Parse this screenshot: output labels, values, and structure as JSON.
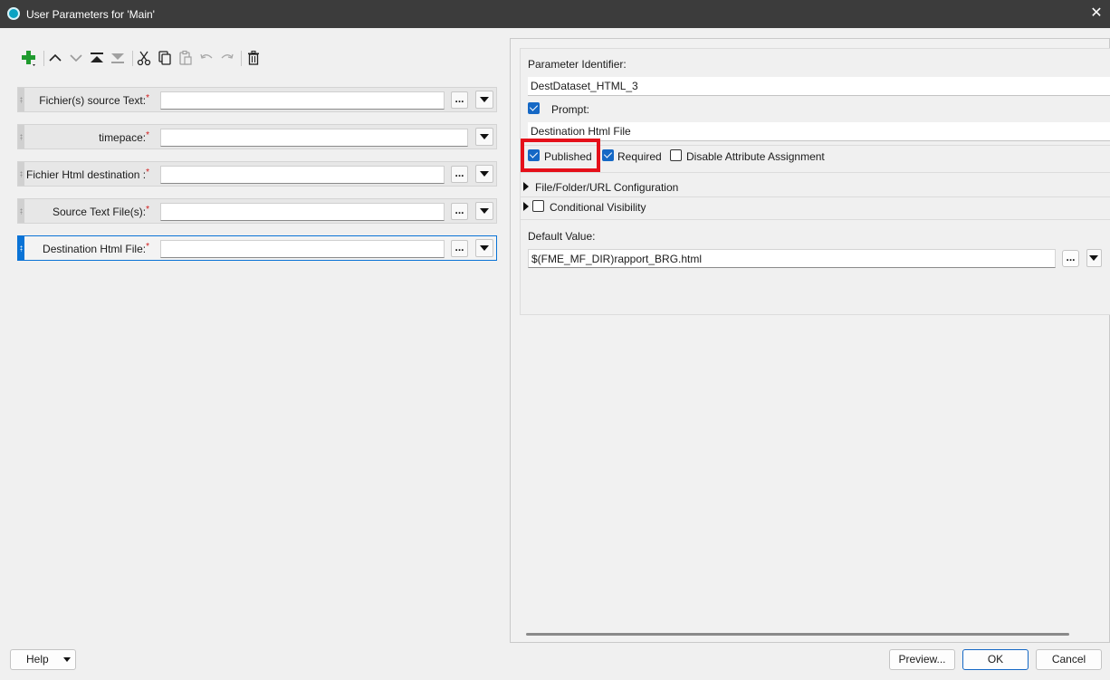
{
  "window": {
    "title": "User Parameters for 'Main'"
  },
  "toolbar": {
    "icons": [
      "add-icon",
      "move-up-icon",
      "move-down-icon",
      "move-top-icon",
      "move-bottom-icon",
      "cut-icon",
      "copy-icon",
      "paste-icon",
      "undo-icon",
      "redo-icon",
      "delete-icon"
    ]
  },
  "parameters": [
    {
      "label": "Fichier(s) source Text:",
      "required_mark": "*",
      "value": "",
      "has_browse": true,
      "browse_label": "..."
    },
    {
      "label": "timepace:",
      "required_mark": "*",
      "value": "",
      "has_browse": false
    },
    {
      "label": "Fichier Html destination :",
      "required_mark": "*",
      "value": "",
      "has_browse": true,
      "browse_label": "..."
    },
    {
      "label": "Source Text File(s):",
      "required_mark": "*",
      "value": "",
      "has_browse": true,
      "browse_label": "..."
    },
    {
      "label": "Destination Html File:",
      "required_mark": "*",
      "value": "",
      "has_browse": true,
      "browse_label": "...",
      "selected": true
    }
  ],
  "details": {
    "identifier_label": "Parameter Identifier:",
    "identifier_value": "DestDataset_HTML_3",
    "prompt_label": "Prompt:",
    "prompt_checked": true,
    "prompt_value": "Destination Html File",
    "published_label": "Published",
    "published_checked": true,
    "required_label": "Required",
    "required_checked": true,
    "disable_attr_label": "Disable Attribute Assignment",
    "disable_attr_checked": false,
    "file_config_label": "File/Folder/URL Configuration",
    "conditional_label": "Conditional Visibility",
    "conditional_checked": false,
    "default_label": "Default Value:",
    "default_value": "$(FME_MF_DIR)rapport_BRG.html",
    "browse_label": "..."
  },
  "buttons": {
    "help": "Help",
    "preview": "Preview...",
    "ok": "OK",
    "cancel": "Cancel"
  },
  "colors": {
    "title_bar": "#3c3c3c",
    "accent": "#1568c5",
    "highlight": "#e5101a",
    "required": "#d01818"
  }
}
